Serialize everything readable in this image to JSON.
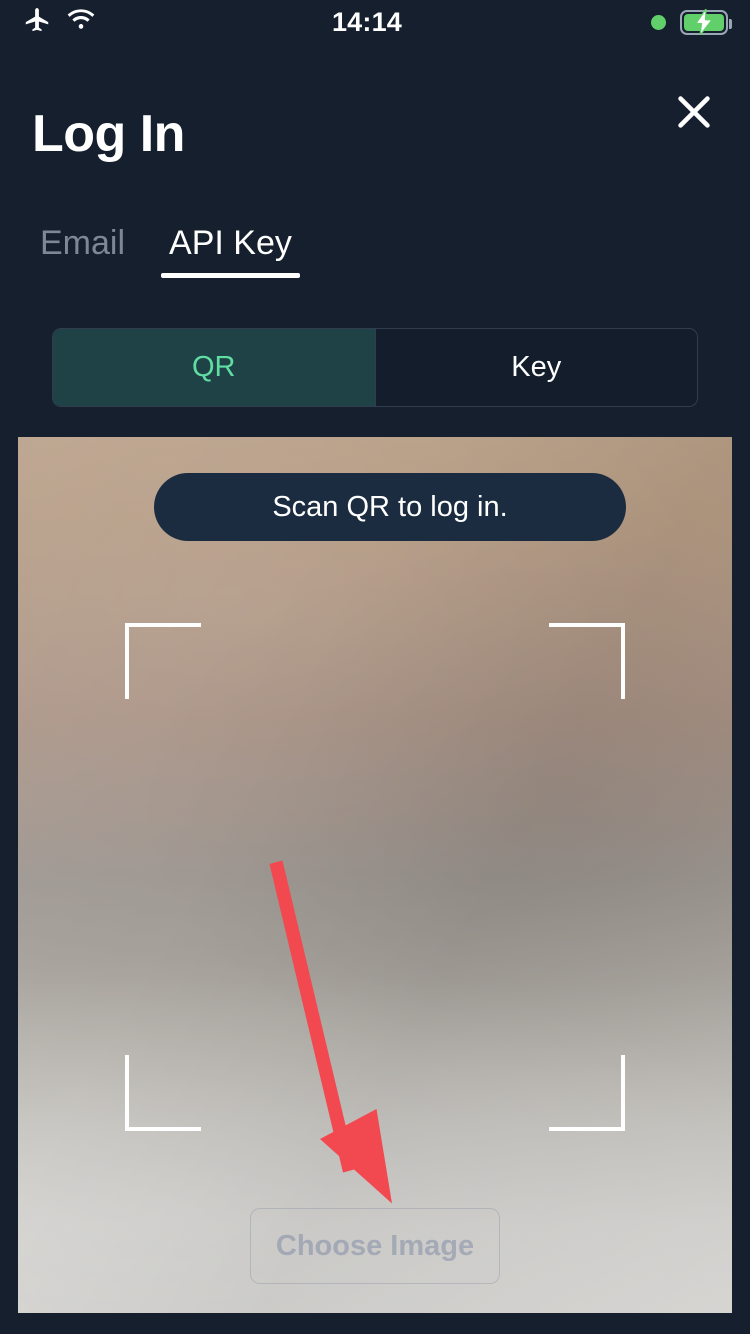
{
  "statusbar": {
    "airplane_icon": "airplane-mode-icon",
    "wifi_icon": "wifi-icon",
    "time": "14:14",
    "recording_dot": "green-status-dot",
    "battery_icon": "battery-charging-icon"
  },
  "header": {
    "title": "Log In",
    "close_icon": "close-icon"
  },
  "tabs": [
    {
      "label": "Email",
      "active": false
    },
    {
      "label": "API Key",
      "active": true
    }
  ],
  "segmented": {
    "options": [
      {
        "label": "QR",
        "selected": true
      },
      {
        "label": "Key",
        "selected": false
      }
    ]
  },
  "camera": {
    "banner_text": "Scan QR to log in.",
    "choose_image_label": "Choose Image",
    "scan_frame_icon": "qr-scan-frame-icon",
    "annotation_icon": "red-arrow-annotation-icon"
  },
  "colors": {
    "background": "#151f2e",
    "accent_green": "#5fdda2",
    "segment_selected_bg": "#1e4246",
    "banner_bg": "#1c2c40",
    "annotation_red": "#F2484F",
    "battery_green": "#61d06a",
    "tab_inactive": "#7d8894"
  }
}
